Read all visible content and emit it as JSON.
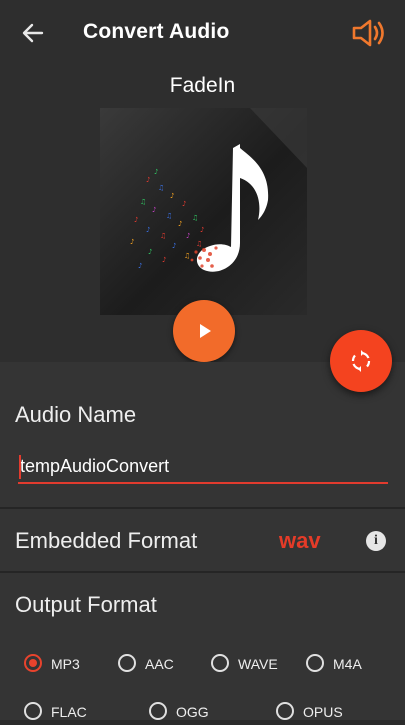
{
  "appbar": {
    "title": "Convert Audio"
  },
  "player": {
    "track_title": "FadeIn"
  },
  "form": {
    "audio_name_label": "Audio Name",
    "audio_name_value": "tempAudioConvert",
    "embedded_format_label": "Embedded Format",
    "embedded_format_value": "wav",
    "info_glyph": "i",
    "output_format_label": "Output Format",
    "output_formats": [
      {
        "label": "MP3",
        "selected": true
      },
      {
        "label": "AAC",
        "selected": false
      },
      {
        "label": "WAVE",
        "selected": false
      },
      {
        "label": "M4A",
        "selected": false
      },
      {
        "label": "FLAC",
        "selected": false
      },
      {
        "label": "OGG",
        "selected": false
      },
      {
        "label": "OPUS",
        "selected": false
      }
    ]
  },
  "colors": {
    "accent": "#f26b2a",
    "fab": "#f4431f",
    "highlight": "#e43b28",
    "panel": "#343434"
  },
  "icons": [
    "back-arrow-icon",
    "speaker-icon",
    "play-icon",
    "convert-sync-icon",
    "info-icon",
    "music-note-icon"
  ]
}
